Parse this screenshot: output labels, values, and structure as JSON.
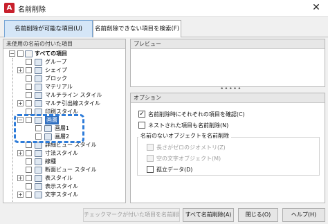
{
  "window": {
    "title": "名前削除",
    "app_icon_letter": "A",
    "close_glyph": "✕"
  },
  "tabs": [
    {
      "label": "名前削除が可能な項目(U)",
      "active": true
    },
    {
      "label": "名前削除できない項目を検索(F)",
      "active": false
    }
  ],
  "tree": {
    "header": "未使用の名前の付いた項目",
    "root": "すべての項目",
    "items": [
      "グループ",
      "シェイプ",
      "ブロック",
      "マテリアル",
      "マルチライン スタイル",
      "マルチ引出線スタイル",
      "印刷スタイル",
      "画層",
      "画層1",
      "画層2",
      "詳細ビュー スタイル",
      "寸法スタイル",
      "線種",
      "断面ビュー スタイル",
      "表スタイル",
      "表示スタイル",
      "文字スタイル"
    ]
  },
  "preview": {
    "header": "プレビュー"
  },
  "splitter_glyph": "•••••",
  "options": {
    "header": "オプション",
    "confirm_each": {
      "label": "名前削除時にそれぞれの項目を確認(C)",
      "checked": true
    },
    "purge_nested": {
      "label": "ネストされた項目も名前削除(N)",
      "checked": false
    },
    "unnamed_group_label": "名前のないオブジェクトを名前削除",
    "zero_length": {
      "label": "長さがゼロのジオメトリ(Z)",
      "checked": false,
      "enabled": false
    },
    "empty_text": {
      "label": "空の文字オブジェクト(M)",
      "checked": false,
      "enabled": false
    },
    "orphaned_data": {
      "label": "孤立データ(D)",
      "checked": false,
      "enabled": true
    }
  },
  "buttons": {
    "purge_checked": "チェックマークが付いた項目を名前削除(P)",
    "purge_all": "すべて名前削除(A)",
    "close": "閉じる(O)",
    "help": "ヘルプ(H)"
  },
  "colors": {
    "selection": "#2f6fc1",
    "annotation": "#2e7cd9",
    "app_icon": "#c8202c"
  }
}
